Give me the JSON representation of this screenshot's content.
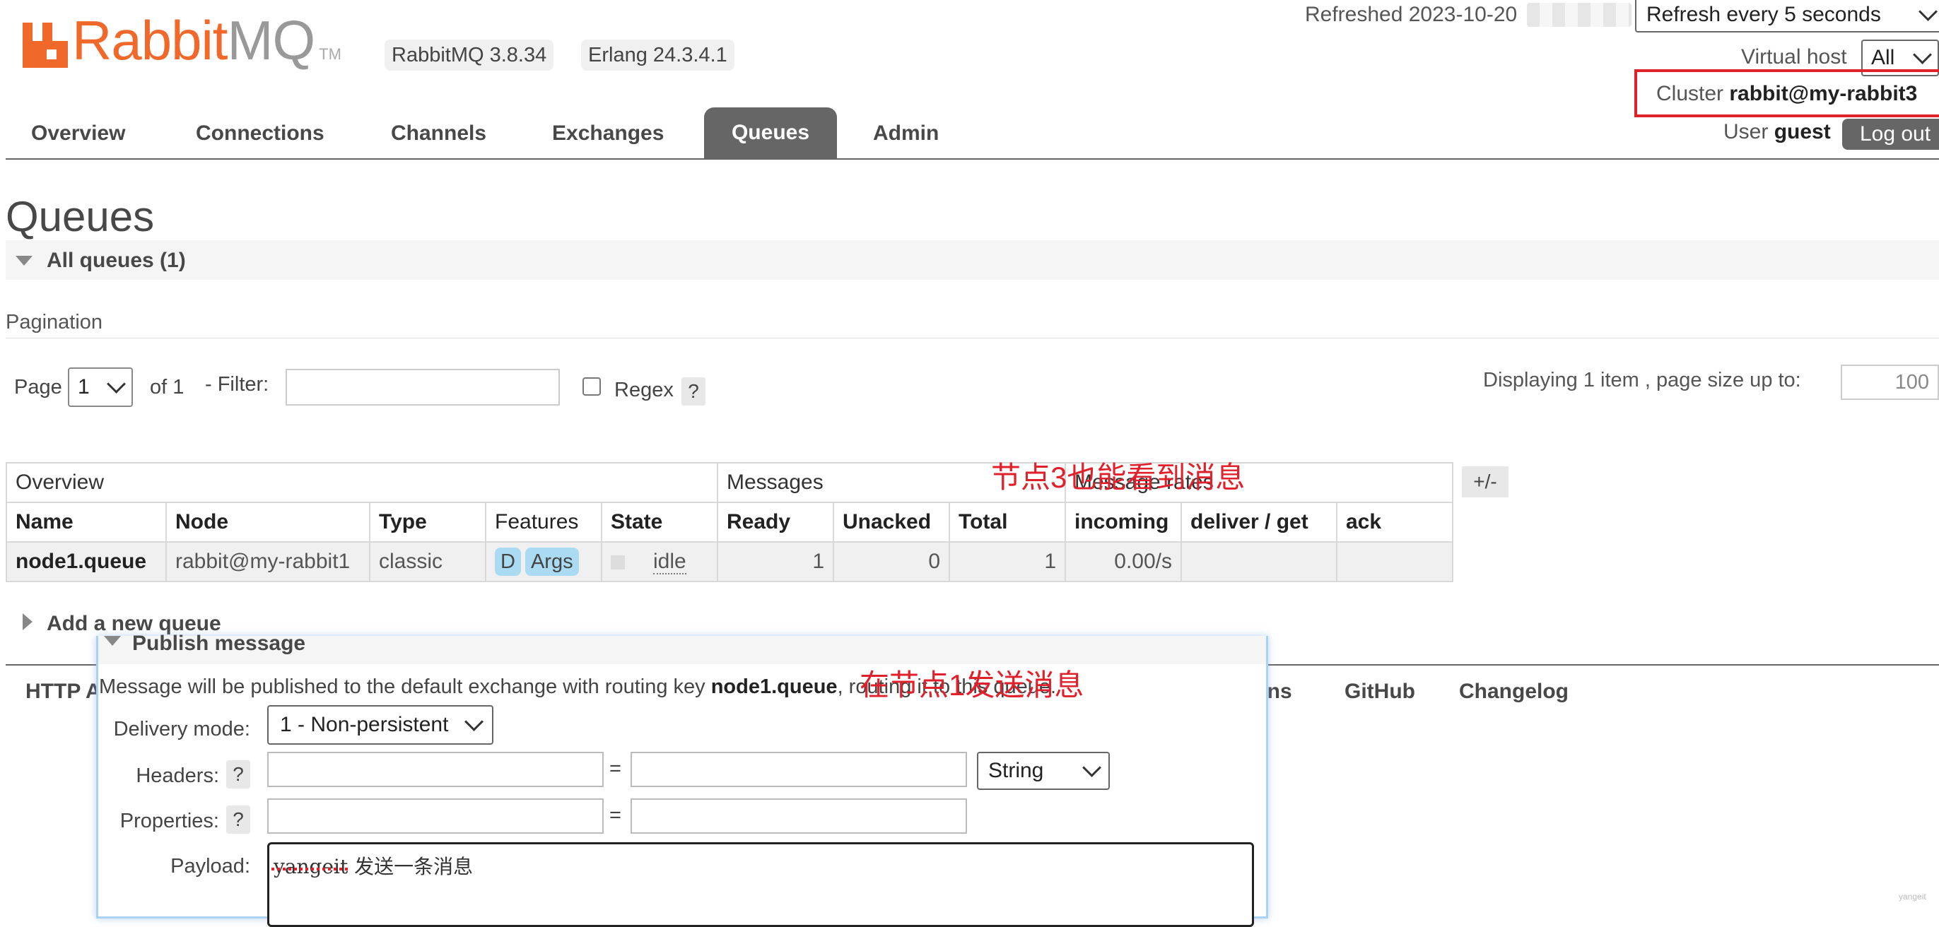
{
  "brand": {
    "rabbit": "Rabbit",
    "mq": "MQ",
    "tm": "TM"
  },
  "versions": {
    "rabbitmq": "RabbitMQ 3.8.34",
    "erlang": "Erlang 24.3.4.1"
  },
  "top_right": {
    "refreshed": "Refreshed 2023-10-20",
    "refresh_option": "Refresh every 5 seconds",
    "vhost_label": "Virtual host",
    "vhost_value": "All",
    "cluster_label": "Cluster",
    "cluster_value": "rabbit@my-rabbit3",
    "user_label": "User",
    "user_value": "guest",
    "logout": "Log out"
  },
  "nav": [
    "Overview",
    "Connections",
    "Channels",
    "Exchanges",
    "Queues",
    "Admin"
  ],
  "page_title": "Queues",
  "all_queues": "All queues (1)",
  "pagination": {
    "title": "Pagination",
    "page_label": "Page",
    "page_value": "1",
    "of": "of 1",
    "filter_label": "- Filter:",
    "regex_label": "Regex",
    "help": "?",
    "displaying": "Displaying 1 item , page size up to:",
    "page_size": "100"
  },
  "table": {
    "group_overview": "Overview",
    "group_messages": "Messages",
    "group_rates": "Message rates",
    "plusminus": "+/-",
    "headers": [
      "Name",
      "Node",
      "Type",
      "Features",
      "State",
      "Ready",
      "Unacked",
      "Total",
      "incoming",
      "deliver / get",
      "ack"
    ],
    "row": {
      "name": "node1.queue",
      "node": "rabbit@my-rabbit1",
      "type": "classic",
      "feature_d": "D",
      "feature_args": "Args",
      "state": "idle",
      "ready": "1",
      "unacked": "0",
      "total": "1",
      "incoming": "0.00/s",
      "deliver_get": "",
      "ack": ""
    }
  },
  "annotations": {
    "node3": "节点3也能看到消息",
    "node1": "在节点1发送消息"
  },
  "add_queue": "Add a new queue",
  "footer": {
    "http": "HTTP A",
    "plugins": "gins",
    "github": "GitHub",
    "changelog": "Changelog"
  },
  "publish": {
    "title": "Publish message",
    "desc_prefix": "Message will be published to the default exchange with routing key",
    "desc_key": "node1.queue",
    "desc_suffix": ", routing it to this queue.",
    "delivery_label": "Delivery mode:",
    "delivery_value": "1 - Non-persistent",
    "headers_label": "Headers:",
    "properties_label": "Properties:",
    "equals": "=",
    "header_type": "String",
    "payload_label": "Payload:",
    "payload_value": "yangeit 发送一条消息",
    "help": "?"
  },
  "watermark": "yangeit"
}
